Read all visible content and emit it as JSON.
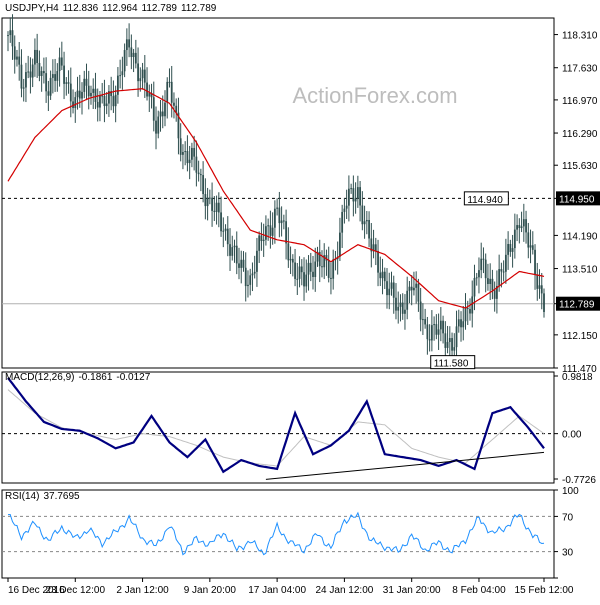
{
  "price_header": {
    "symbol": "USDJPY,H4",
    "open": "112.836",
    "high": "112.964",
    "low": "112.789",
    "close": "112.789"
  },
  "watermark": "ActionForex.com",
  "macd_header": {
    "label": "MACD(12,26,9)",
    "macd": "-0.1861",
    "signal": "-0.0127"
  },
  "rsi_header": {
    "label": "RSI(14)",
    "value": "37.7695"
  },
  "colors": {
    "candles": "#2f4f4f",
    "moving_average": "#d40000",
    "macd_line": "#000080",
    "macd_signal": "#c0c0c0",
    "rsi_line": "#1e90ff",
    "trendline": "#000000",
    "reference_line": "#000000"
  },
  "chart_data": [
    {
      "panel": "price",
      "type": "candlestick",
      "ylim": [
        111.47,
        118.65
      ],
      "y_ticks": [
        "118.310",
        "117.630",
        "116.970",
        "116.290",
        "115.630",
        "114.950",
        "114.190",
        "113.510",
        "112.789",
        "112.150",
        "111.470"
      ],
      "y_tick_values": [
        118.31,
        117.63,
        116.97,
        116.29,
        115.63,
        114.95,
        114.19,
        113.51,
        112.789,
        112.15,
        111.47
      ],
      "resistance_level": 114.95,
      "resistance_label": "114.950",
      "current_price": 112.789,
      "current_price_label": "112.789",
      "annotations": [
        {
          "text": "114.940",
          "x": "15 Feb 00:00",
          "y": 114.94
        },
        {
          "text": "111.580",
          "x": "7 Feb 20:00",
          "y": 111.58
        }
      ],
      "moving_average_series": {
        "name": "",
        "type": "line",
        "x_index": [
          0,
          12,
          24,
          36,
          48,
          60,
          72,
          84,
          96,
          108,
          120,
          132,
          144,
          156,
          168,
          180,
          192,
          204,
          216,
          228,
          239
        ],
        "values": [
          115.3,
          116.2,
          116.75,
          117.0,
          117.15,
          117.2,
          116.9,
          116.1,
          115.1,
          114.3,
          114.1,
          114.0,
          113.65,
          114.0,
          113.8,
          113.35,
          112.85,
          112.7,
          113.05,
          113.45,
          113.35
        ]
      },
      "candle_series": {
        "name": "USDJPY",
        "ohlc_approx_from_pixels": true,
        "x_anchors": [
          0,
          6,
          12,
          18,
          24,
          30,
          36,
          42,
          48,
          54,
          60,
          66,
          72,
          78,
          84,
          90,
          96,
          102,
          108,
          114,
          120,
          126,
          132,
          138,
          144,
          150,
          156,
          162,
          168,
          174,
          180,
          186,
          192,
          198,
          204,
          210,
          216,
          222,
          228,
          234,
          239
        ],
        "close_anchors": [
          118.3,
          117.4,
          117.7,
          117.3,
          117.6,
          116.9,
          117.3,
          116.8,
          117.2,
          118.1,
          117.4,
          116.5,
          117.2,
          115.9,
          115.6,
          114.8,
          114.4,
          113.6,
          113.3,
          114.2,
          114.7,
          113.7,
          113.2,
          113.8,
          113.3,
          114.8,
          115.1,
          113.9,
          113.3,
          112.6,
          113.2,
          112.3,
          112.2,
          112.0,
          112.5,
          113.6,
          113.1,
          113.6,
          114.6,
          113.7,
          112.8
        ]
      },
      "x_ticks": [
        "16 Dec 2016",
        "23 Dec 12:00",
        "2 Jan 12:00",
        "9 Jan 20:00",
        "17 Jan 04:00",
        "24 Jan 12:00",
        "31 Jan 20:00",
        "8 Feb 04:00",
        "15 Feb 12:00"
      ],
      "x_tick_index": [
        0,
        30,
        60,
        90,
        120,
        150,
        180,
        210,
        240
      ]
    },
    {
      "panel": "macd",
      "type": "line",
      "ylim": [
        -0.7726,
        0.9818
      ],
      "y_ticks": [
        "0.9818",
        "0.00",
        "-0.7726"
      ],
      "y_tick_values": [
        0.9818,
        0.0,
        -0.7726
      ],
      "zero_line": 0.0,
      "series": [
        {
          "name": "MACD",
          "x_index": [
            0,
            8,
            16,
            24,
            32,
            40,
            48,
            56,
            64,
            72,
            80,
            88,
            96,
            104,
            112,
            120,
            128,
            136,
            144,
            152,
            160,
            168,
            176,
            184,
            192,
            200,
            208,
            216,
            224,
            232,
            239
          ],
          "values": [
            0.95,
            0.55,
            0.2,
            0.08,
            0.05,
            -0.08,
            -0.25,
            -0.15,
            0.3,
            -0.15,
            -0.4,
            -0.1,
            -0.65,
            -0.45,
            -0.55,
            -0.6,
            0.35,
            -0.35,
            -0.2,
            0.05,
            0.55,
            -0.35,
            -0.4,
            -0.45,
            -0.55,
            -0.45,
            -0.6,
            0.35,
            0.45,
            0.1,
            -0.25
          ]
        },
        {
          "name": "Signal",
          "x_index": [
            0,
            12,
            24,
            36,
            48,
            60,
            72,
            84,
            96,
            108,
            120,
            132,
            144,
            156,
            168,
            180,
            192,
            204,
            216,
            228,
            239
          ],
          "values": [
            0.75,
            0.35,
            0.1,
            0.0,
            -0.1,
            0.0,
            -0.05,
            -0.2,
            -0.4,
            -0.5,
            -0.55,
            -0.05,
            -0.2,
            0.2,
            0.15,
            -0.25,
            -0.4,
            -0.5,
            -0.1,
            0.3,
            0.0
          ]
        }
      ],
      "trendline": {
        "from": [
          115,
          -0.78
        ],
        "to": [
          239,
          -0.32
        ]
      }
    },
    {
      "panel": "rsi",
      "type": "line",
      "ylim": [
        0,
        100
      ],
      "y_ticks": [
        "100",
        "70",
        "30",
        "0"
      ],
      "y_tick_values": [
        100,
        70,
        30,
        0
      ],
      "reference_levels": [
        70,
        30
      ],
      "series": [
        {
          "name": "RSI(14)",
          "x_index": [
            0,
            6,
            12,
            18,
            24,
            30,
            36,
            42,
            48,
            54,
            60,
            66,
            72,
            78,
            84,
            90,
            96,
            102,
            108,
            114,
            120,
            126,
            132,
            138,
            144,
            150,
            156,
            162,
            168,
            174,
            180,
            186,
            192,
            198,
            204,
            210,
            216,
            222,
            228,
            234,
            239
          ],
          "values": [
            72,
            48,
            62,
            42,
            58,
            45,
            55,
            40,
            52,
            68,
            45,
            36,
            60,
            30,
            44,
            38,
            52,
            32,
            42,
            28,
            58,
            40,
            32,
            50,
            34,
            66,
            70,
            42,
            36,
            30,
            48,
            32,
            40,
            30,
            44,
            68,
            50,
            58,
            72,
            48,
            38
          ]
        }
      ]
    }
  ]
}
